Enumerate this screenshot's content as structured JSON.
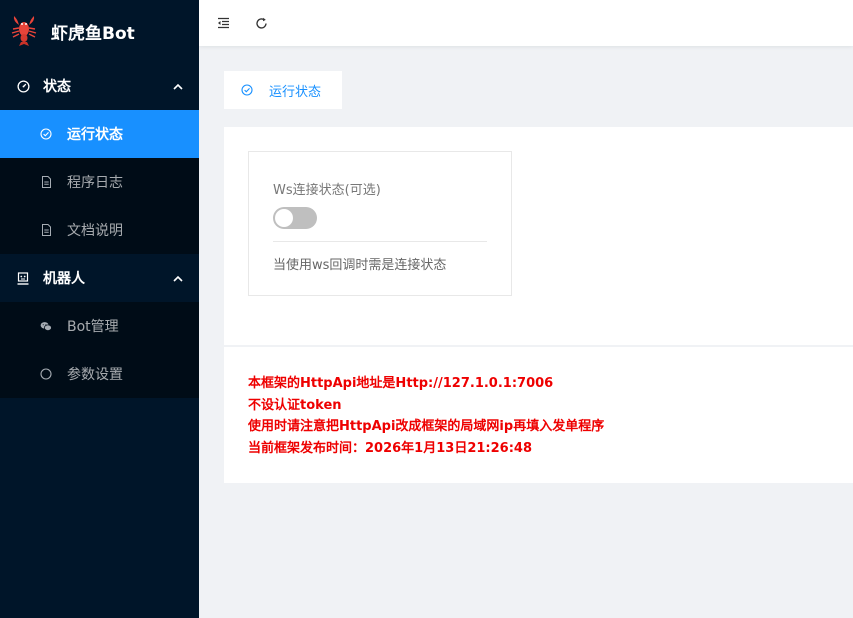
{
  "app": {
    "title": "虾虎鱼Bot"
  },
  "sidebar": {
    "groups": [
      {
        "label": "状态",
        "icon": "dashboard-icon",
        "items": [
          {
            "label": "运行状态",
            "icon": "check-circle-icon",
            "active": true
          },
          {
            "label": "程序日志",
            "icon": "file-icon"
          },
          {
            "label": "文档说明",
            "icon": "file-icon"
          }
        ]
      },
      {
        "label": "机器人",
        "icon": "robot-icon",
        "items": [
          {
            "label": "Bot管理",
            "icon": "wechat-icon"
          },
          {
            "label": "参数设置",
            "icon": "circle-icon"
          }
        ]
      }
    ]
  },
  "header": {
    "icons": [
      "menu-fold-icon",
      "reload-icon"
    ]
  },
  "tab": {
    "label": "运行状态",
    "icon": "check-circle-icon"
  },
  "ws_card": {
    "title": "Ws连接状态(可选)",
    "switch_on": false,
    "description": "当使用ws回调时需是连接状态"
  },
  "info": {
    "lines": [
      "本框架的HttpApi地址是Http://127.1.0.1:7006",
      "不设认证token",
      "使用时请注意把HttpApi改成框架的局域网ip再填入发单程序",
      "当前框架发布时间：2026年1月13日21:26:48"
    ]
  },
  "colors": {
    "sidebar_bg": "#001529",
    "accent": "#1890ff",
    "warning_text": "#ee0000"
  }
}
